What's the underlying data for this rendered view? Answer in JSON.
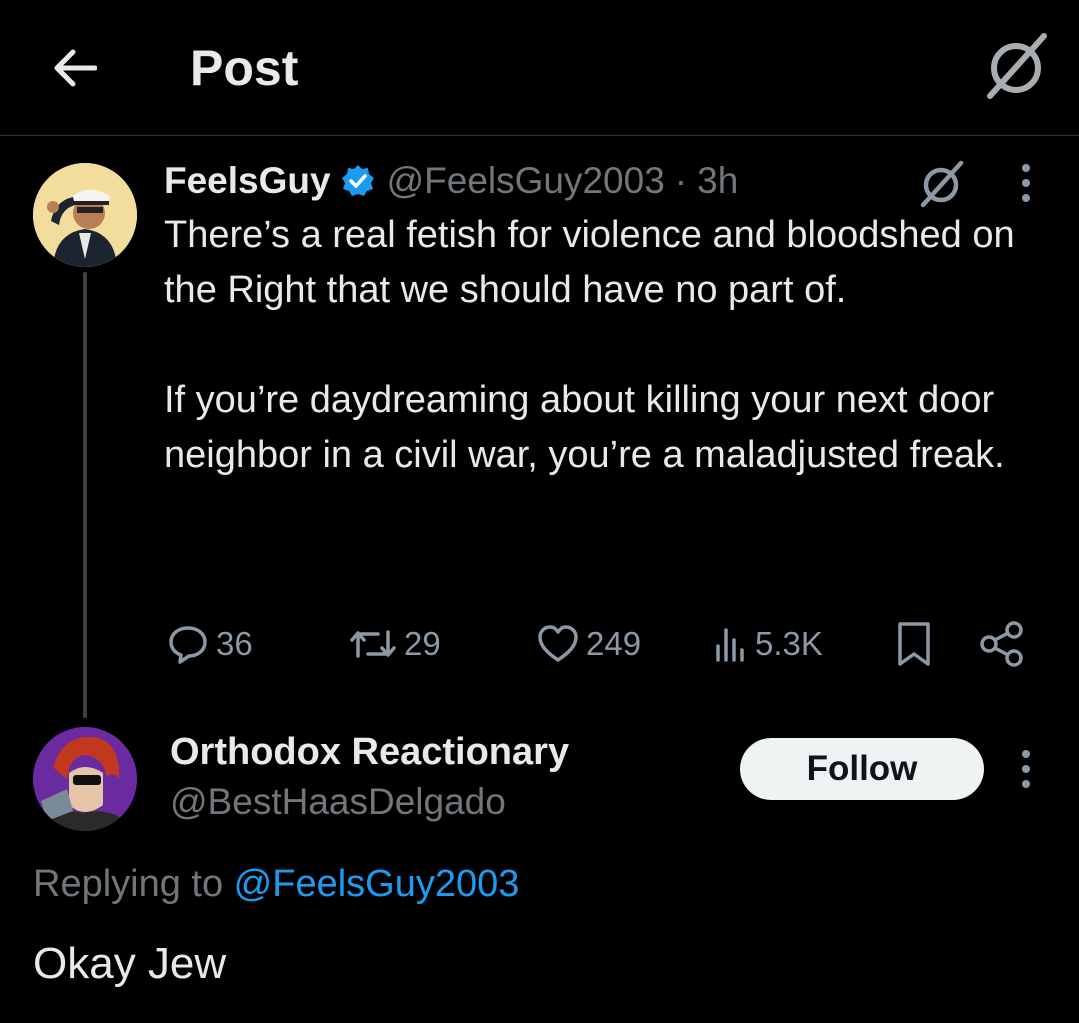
{
  "header": {
    "title": "Post",
    "back_icon": "arrow-left-icon",
    "grok_icon": "grok-icon"
  },
  "tweet": {
    "display_name": "FeelsGuy",
    "verified": true,
    "handle": "@FeelsGuy2003",
    "separator": "·",
    "time": "3h",
    "paragraphs": [
      "There’s a real fetish for violence and bloodshed on the Right that we should have no part of.",
      "If you’re daydreaming about killing your next door neighbor in a civil war, you’re a maladjusted freak."
    ],
    "actions": {
      "replies": "36",
      "reposts": "29",
      "likes": "249",
      "views": "5.3K"
    }
  },
  "reply": {
    "display_name": "Orthodox Reactionary",
    "handle": "@BestHaasDelgado",
    "follow_label": "Follow",
    "replying_prefix": "Replying to ",
    "replying_to": "@FeelsGuy2003",
    "text": "Okay Jew"
  },
  "colors": {
    "background": "#000000",
    "text_primary": "#e7e9ea",
    "text_secondary": "#71767b",
    "accent_blue": "#1d9bf0",
    "divider": "#2f3336"
  }
}
